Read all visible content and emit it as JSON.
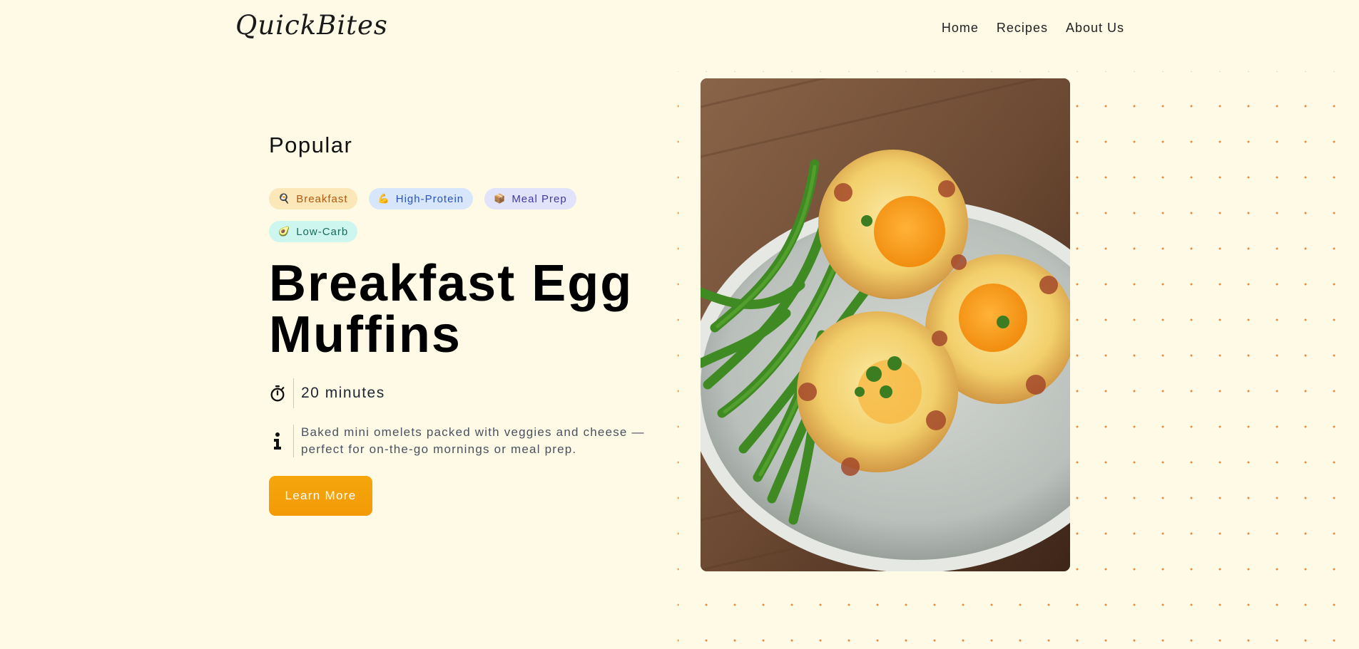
{
  "header": {
    "logo": "QuickBites",
    "nav": [
      "Home",
      "Recipes",
      "About Us"
    ]
  },
  "hero": {
    "eyebrow": "Popular",
    "tags": [
      {
        "icon": "🍳",
        "label": "Breakfast"
      },
      {
        "icon": "💪",
        "label": "High-Protein"
      },
      {
        "icon": "📦",
        "label": "Meal Prep"
      },
      {
        "icon": "🥑",
        "label": "Low-Carb"
      }
    ],
    "title": "Breakfast Egg Muffins",
    "time_icon": "stopwatch-icon",
    "time": "20 minutes",
    "info_icon": "info-icon",
    "description": "Baked mini omelets packed with veggies and cheese — perfect for on-the-go mornings or meal prep.",
    "cta": "Learn More",
    "image_subject": "egg-muffins-with-green-beans-photo"
  },
  "colors": {
    "background": "#fefae6",
    "accent": "#f6a60c",
    "dots": "#e9863a"
  }
}
